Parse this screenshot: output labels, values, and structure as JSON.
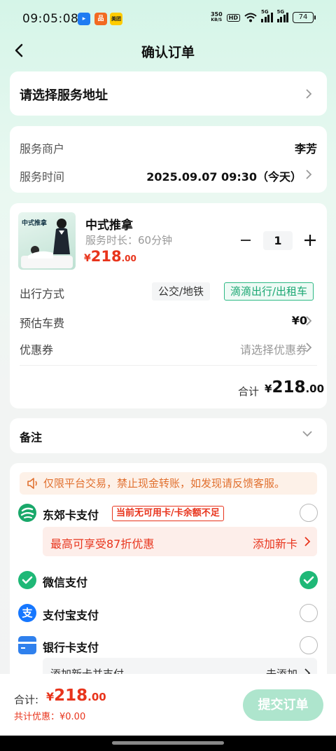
{
  "status_bar": {
    "time": "09:05:08",
    "net_speed_value": "350",
    "net_speed_unit": "KB/S",
    "hd": "HD",
    "signal_1": "5G",
    "signal_2": "5G",
    "battery": "74",
    "app_icons": [
      {
        "name": "app-blue-icon",
        "color": "#1f7cf2",
        "glyph": "▸"
      },
      {
        "name": "app-orange-icon",
        "color": "#f26a21",
        "glyph": "品"
      },
      {
        "name": "meituan-icon",
        "color": "#ffcc00",
        "glyph": "美团"
      }
    ]
  },
  "nav": {
    "title": "确认订单"
  },
  "address": {
    "placeholder": "请选择服务地址"
  },
  "provider": {
    "merchant_label": "服务商户",
    "merchant_value": "李芳",
    "time_label": "服务时间",
    "time_value": "2025.09.07 09:30（今天）"
  },
  "service": {
    "image_title": "中式推拿",
    "name": "中式推拿",
    "duration": "服务时长：60分钟",
    "price_currency": "¥",
    "price_int": "218",
    "price_dec": ".00",
    "quantity": "1",
    "travel_label": "出行方式",
    "travel_options": [
      "公交/地铁",
      "滴滴出行/出租车"
    ],
    "travel_selected": "滴滴出行/出租车",
    "fare_label": "预估车费",
    "fare_value": "¥0",
    "coupon_label": "优惠券",
    "coupon_value": "请选择优惠券",
    "total_label": "合计",
    "total_currency": "¥",
    "total_int": "218",
    "total_dec": ".00"
  },
  "remark": {
    "label": "备注"
  },
  "payment": {
    "notice": "仅限平台交易，禁止现金转账，如发现请反馈客服。",
    "dongjiao": {
      "label": "东郊卡支付",
      "tag": "当前无可用卡/卡余额不足",
      "promo_text": "最高可享受87折优惠",
      "promo_link": "添加新卡"
    },
    "wechat": {
      "label": "微信支付",
      "selected": true
    },
    "alipay": {
      "label": "支付宝支付",
      "selected": false
    },
    "bank": {
      "label": "银行卡支付",
      "selected": false,
      "sub_text": "添加新卡并支付",
      "sub_link": "去添加"
    },
    "colors": {
      "wechat": "#1fb877",
      "alipay": "#1677ff",
      "bank": "#2f80ed",
      "dongjiao": "#19a86a"
    }
  },
  "bottom": {
    "total_label": "合计:",
    "price_currency": "¥",
    "price_int": "218",
    "price_dec": ".00",
    "discount": "共计优惠：¥0.00",
    "submit_label": "提交订单"
  },
  "colors": {
    "accent_green": "#1fb877",
    "price_red": "#e8341c",
    "notice_orange": "#e1702f"
  }
}
